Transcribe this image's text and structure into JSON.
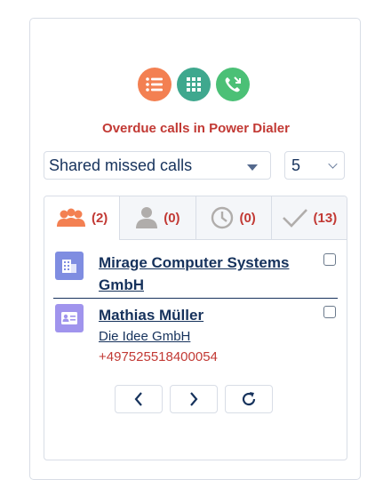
{
  "header": {
    "title": "Overdue calls in Power Dialer"
  },
  "actions": [
    {
      "icon": "list-icon",
      "color": "#f38052"
    },
    {
      "icon": "dialpad-icon",
      "color": "#3fa88e"
    },
    {
      "icon": "missed-call-icon",
      "color": "#4bc076"
    }
  ],
  "filters": {
    "list_value": "Shared missed calls",
    "count_value": "5"
  },
  "tabs": [
    {
      "icon": "group-icon",
      "count": "(2)",
      "active": true
    },
    {
      "icon": "person-icon",
      "count": "(0)",
      "active": false
    },
    {
      "icon": "clock-icon",
      "count": "(0)",
      "active": false
    },
    {
      "icon": "checkmark-icon",
      "count": "(13)",
      "active": false
    }
  ],
  "records": [
    {
      "icon": "account-icon",
      "name": "Mirage Computer Systems GmbH"
    },
    {
      "icon": "contact-icon",
      "name": "Mathias Müller",
      "company": "Die Idee GmbH",
      "phone": "+497525518400054"
    }
  ],
  "pager": [
    {
      "icon": "chevron-left-icon"
    },
    {
      "icon": "chevron-right-icon"
    },
    {
      "icon": "refresh-icon"
    }
  ]
}
